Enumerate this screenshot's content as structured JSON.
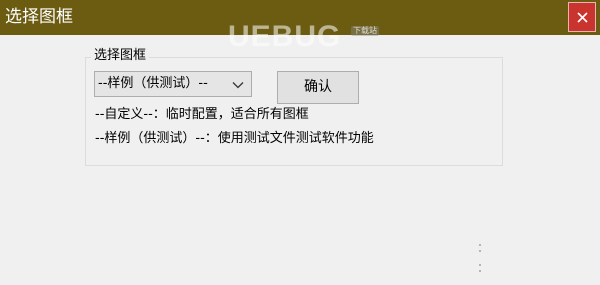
{
  "window": {
    "title": "选择图框",
    "close_icon": "close-icon",
    "titlebar_color": "#6b5c12",
    "close_color": "#c9342f"
  },
  "watermark": {
    "text": "UEBUG",
    "sub": "下载站"
  },
  "group": {
    "label": "选择图框"
  },
  "combo": {
    "selected": "--样例（供测试）--",
    "icon": "chevron-down-icon"
  },
  "confirm": {
    "label": "确认"
  },
  "info": {
    "line1": "--自定义--：临时配置，适合所有图框",
    "line2": "--样例（供测试）--：使用测试文件测试软件功能"
  }
}
